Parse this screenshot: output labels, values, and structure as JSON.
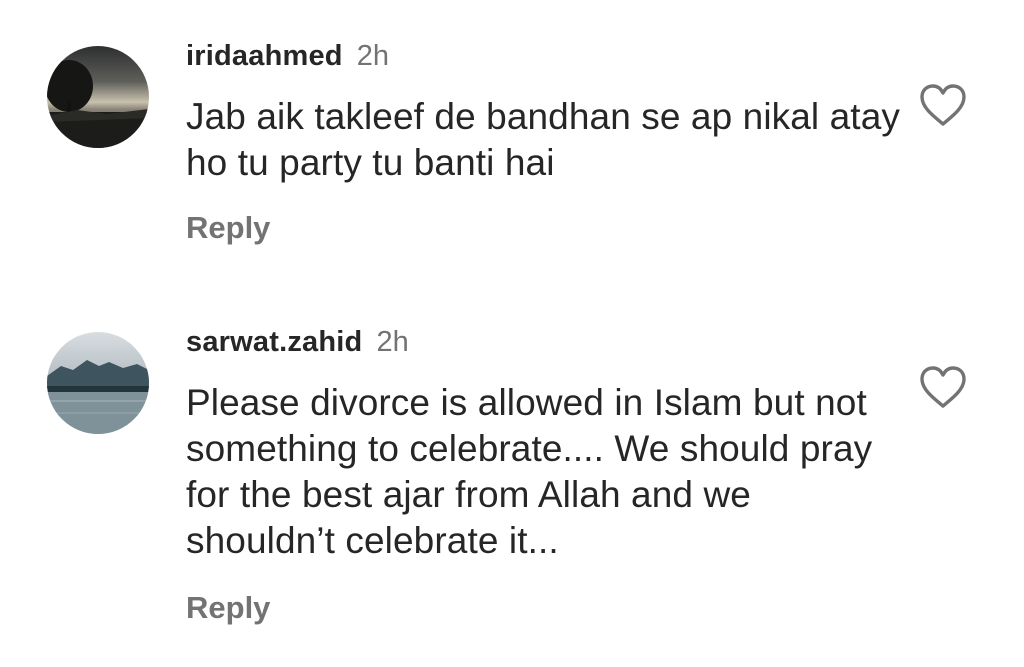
{
  "comments": [
    {
      "username": "iridaahmed",
      "time": "2h",
      "text": "Jab aik takleef de bandhan se ap nikal atay ho tu party tu banti hai",
      "reply_label": "Reply",
      "avatar_icon": "avatar-sunset-tree",
      "like_icon": "heart-outline-icon"
    },
    {
      "username": "sarwat.zahid",
      "time": "2h",
      "text": "Please divorce is allowed in Islam but not something to celebrate.... We should pray for the best ajar from Allah and we shouldn’t celebrate it...",
      "reply_label": "Reply",
      "avatar_icon": "avatar-lake-mountains",
      "like_icon": "heart-outline-icon"
    }
  ],
  "colors": {
    "text_primary": "#262626",
    "text_secondary": "#737373",
    "background": "#ffffff"
  }
}
